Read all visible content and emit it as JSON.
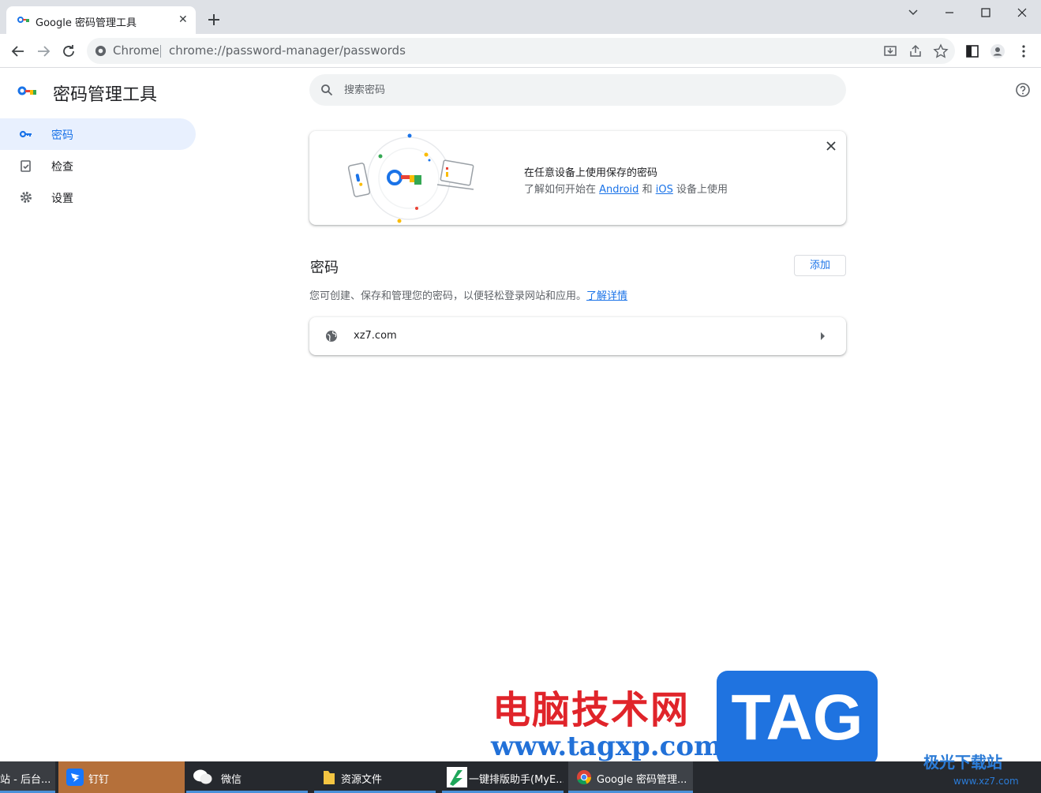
{
  "browser": {
    "tab_title": "Google 密码管理工具",
    "omnibox_chip": "Chrome",
    "url": "chrome://password-manager/passwords"
  },
  "app": {
    "title": "密码管理工具",
    "nav": [
      {
        "label": "密码",
        "icon": "key-icon",
        "active": true
      },
      {
        "label": "检查",
        "icon": "checkup-icon",
        "active": false
      },
      {
        "label": "设置",
        "icon": "gear-icon",
        "active": false
      }
    ],
    "search_placeholder": "搜索密码"
  },
  "promo": {
    "title": "在任意设备上使用保存的密码",
    "line_prefix": "了解如何开始在",
    "android_link": "Android",
    "and": "和",
    "ios_link": "iOS",
    "line_suffix": "设备上使用"
  },
  "passwords": {
    "section_title": "密码",
    "add_label": "添加",
    "description": "您可创建、保存和管理您的密码，以便轻松登录网站和应用。",
    "learn_more": "了解详情",
    "items": [
      {
        "site": "xz7.com"
      }
    ]
  },
  "watermark": {
    "brand": "电脑技术网",
    "url": "www.tagxp.com",
    "tag": "TAG",
    "corner": "极光下载站",
    "corner_url": "www.xz7.com"
  },
  "taskbar": {
    "items": [
      {
        "label": "站 - 后台..."
      },
      {
        "label": "钉钉"
      },
      {
        "label": "微信"
      },
      {
        "label": "资源文件"
      },
      {
        "label": "一键排版助手(MyE..."
      },
      {
        "label": "Google 密码管理..."
      }
    ]
  },
  "colors": {
    "accent": "#1a73e8",
    "active_nav_bg": "#e8f0fe",
    "tabstrip_bg": "#dee1e6",
    "taskbar_bg": "#26292e"
  }
}
